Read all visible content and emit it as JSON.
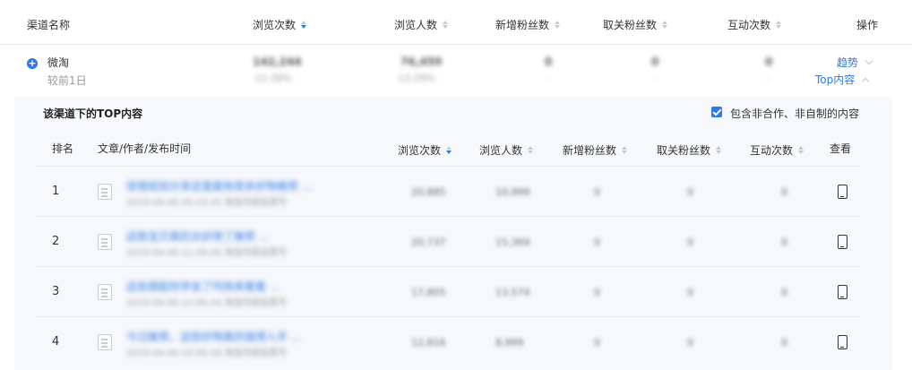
{
  "main_table": {
    "columns": {
      "channel": "渠道名称",
      "views": "浏览次数",
      "visitors": "浏览人数",
      "new_fans": "新增粉丝数",
      "unfollow": "取关粉丝数",
      "interactions": "互动次数",
      "actions": "操作"
    },
    "channel_row": {
      "name": "微淘",
      "sub": "较前1日",
      "views": "142,244",
      "views_change": "12.39%",
      "visitors": "76,459",
      "visitors_change": "13.29%",
      "new_fans": "0",
      "new_fans_change": "-",
      "unfollow": "0",
      "unfollow_change": "-",
      "interactions": "0",
      "interactions_change": "-",
      "trend_link": "趋势",
      "top_link": "Top内容"
    }
  },
  "top_panel": {
    "title": "该渠道下的TOP内容",
    "checkbox_label": "包含非合作、非自制的内容",
    "checkbox_checked": true,
    "columns": {
      "rank": "排名",
      "article": "文章/作者/发布时间",
      "views": "浏览次数",
      "visitors": "浏览人数",
      "new_fans": "新增粉丝数",
      "unfollow": "取关粉丝数",
      "interactions": "互动次数",
      "view": "查看"
    },
    "rows": [
      {
        "rank": "1",
        "title": "穿搭经验分享这里面有很多好物推荐 ...",
        "meta": "2019-04-09 20:23:32   淘宝内容运营号",
        "views": "20,885",
        "visitors": "10,999",
        "new_fans": "0",
        "unfollow": "0",
        "interactions": "0"
      },
      {
        "rank": "2",
        "title": "这款宝贝真的太好用了推荐 ...",
        "meta": "2019-04-09 11:28:20   淘宝内容运营号",
        "views": "20,737",
        "visitors": "15,369",
        "new_fans": "0",
        "unfollow": "0",
        "interactions": "0"
      },
      {
        "rank": "3",
        "title": "这些搭配你学会了吗快来看看 ...",
        "meta": "2019-04-09 12:09:24   淘宝内容运营号",
        "views": "17,805",
        "visitors": "13,574",
        "new_fans": "0",
        "unfollow": "0",
        "interactions": "0"
      },
      {
        "rank": "4",
        "title": "今日推荐，这些好物真的值得入手 ...",
        "meta": "2019-04-09 10:56:18   淘宝内容运营号",
        "views": "12,816",
        "visitors": "8,999",
        "new_fans": "0",
        "unfollow": "0",
        "interactions": "0"
      }
    ]
  },
  "colors": {
    "accent": "#2f78e6",
    "panel_bg": "#f6f8fb"
  }
}
